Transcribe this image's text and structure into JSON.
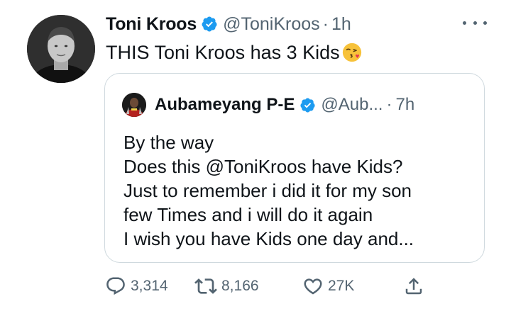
{
  "tweet": {
    "author_name": "Toni Kroos",
    "handle": "@ToniKroos",
    "separator": "·",
    "time": "1h",
    "text": "THIS Toni Kroos has 3 Kids",
    "emoji": "kissing-face-emoji",
    "verified": true
  },
  "quoted_tweet": {
    "author_name": "Aubameyang P-E",
    "handle": "@Aub...",
    "separator": "·",
    "time": "7h",
    "verified": true,
    "lines": [
      "By the way",
      "Does this @ToniKroos have Kids?",
      "Just to remember i did it for my son",
      "few Times and i will do it again",
      "I wish you have Kids one day and..."
    ]
  },
  "actions": {
    "reply": {
      "icon": "reply-icon",
      "count": "3,314"
    },
    "retweet": {
      "icon": "retweet-icon",
      "count": "8,166"
    },
    "like": {
      "icon": "heart-icon",
      "count": "27K"
    },
    "share": {
      "icon": "share-icon"
    }
  },
  "colors": {
    "verified": "#1d9bf0",
    "secondary_text": "#536471",
    "border": "#cfd9de"
  }
}
